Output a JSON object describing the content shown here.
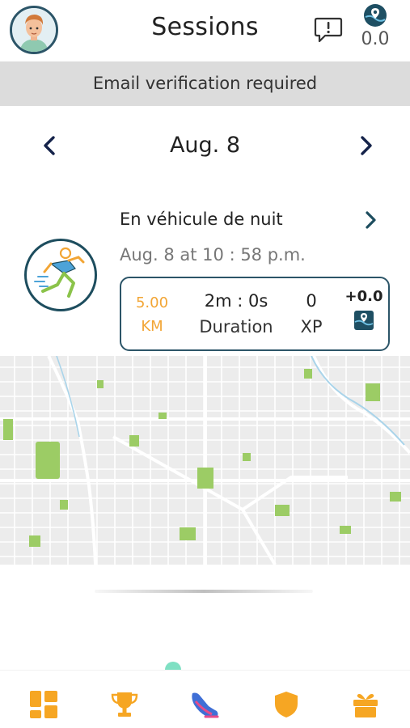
{
  "header": {
    "title": "Sessions",
    "wallet_value": "0.0",
    "avatar_icon": "user-avatar",
    "feedback_icon": "feedback-icon",
    "wallet_icon": "map-pin-coin-icon"
  },
  "banner": {
    "text": "Email verification required"
  },
  "date_nav": {
    "label": "Aug. 8",
    "prev_icon": "chevron-left-icon",
    "next_icon": "chevron-right-icon"
  },
  "session": {
    "title": "En véhicule de nuit",
    "time": "Aug. 8 at 10 : 58 p.m.",
    "activity_icon": "running-person-icon",
    "stats": {
      "distance_value": "5.00",
      "distance_unit": "KM",
      "duration_value": "2m : 0s",
      "duration_label": "Duration",
      "xp_value": "0",
      "xp_label": "XP",
      "coins_value": "+0.0"
    }
  },
  "map": {
    "icon": "city-map"
  },
  "bottom_nav": {
    "items": [
      {
        "icon": "dashboard-icon"
      },
      {
        "icon": "trophy-icon"
      },
      {
        "icon": "sneaker-icon"
      },
      {
        "icon": "shield-icon"
      },
      {
        "icon": "gift-icon"
      }
    ]
  },
  "colors": {
    "accent_orange": "#f6a623",
    "dark_teal": "#1d4d5e",
    "banner_gray": "#dcdcdc",
    "map_green": "#9ccc65",
    "indicator_mint": "#7fe0c3"
  }
}
